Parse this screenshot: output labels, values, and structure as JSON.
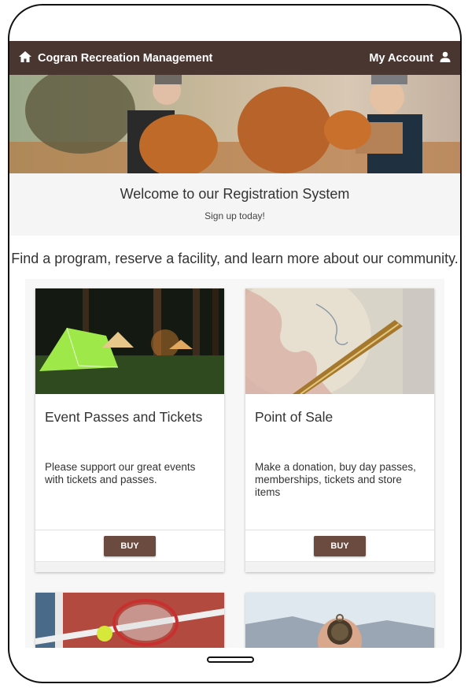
{
  "header": {
    "app_name": "Cogran Recreation Management",
    "account_label": "My Account"
  },
  "welcome": {
    "title": "Welcome to our Registration System",
    "subtitle": "Sign up today!"
  },
  "tagline": "Find a program, reserve a facility, and learn more about our community.",
  "cards": [
    {
      "title": "Event Passes and Tickets",
      "description": "Please support our great events with tickets and passes.",
      "button": "BUY"
    },
    {
      "title": "Point of Sale",
      "description": "Make a donation, buy day passes, memberships, tickets and store items",
      "button": "BUY"
    }
  ],
  "colors": {
    "header_bg": "#4a3630",
    "button_bg": "#6b4a3f"
  },
  "icons": {
    "home": "home-icon",
    "account": "person-icon"
  }
}
